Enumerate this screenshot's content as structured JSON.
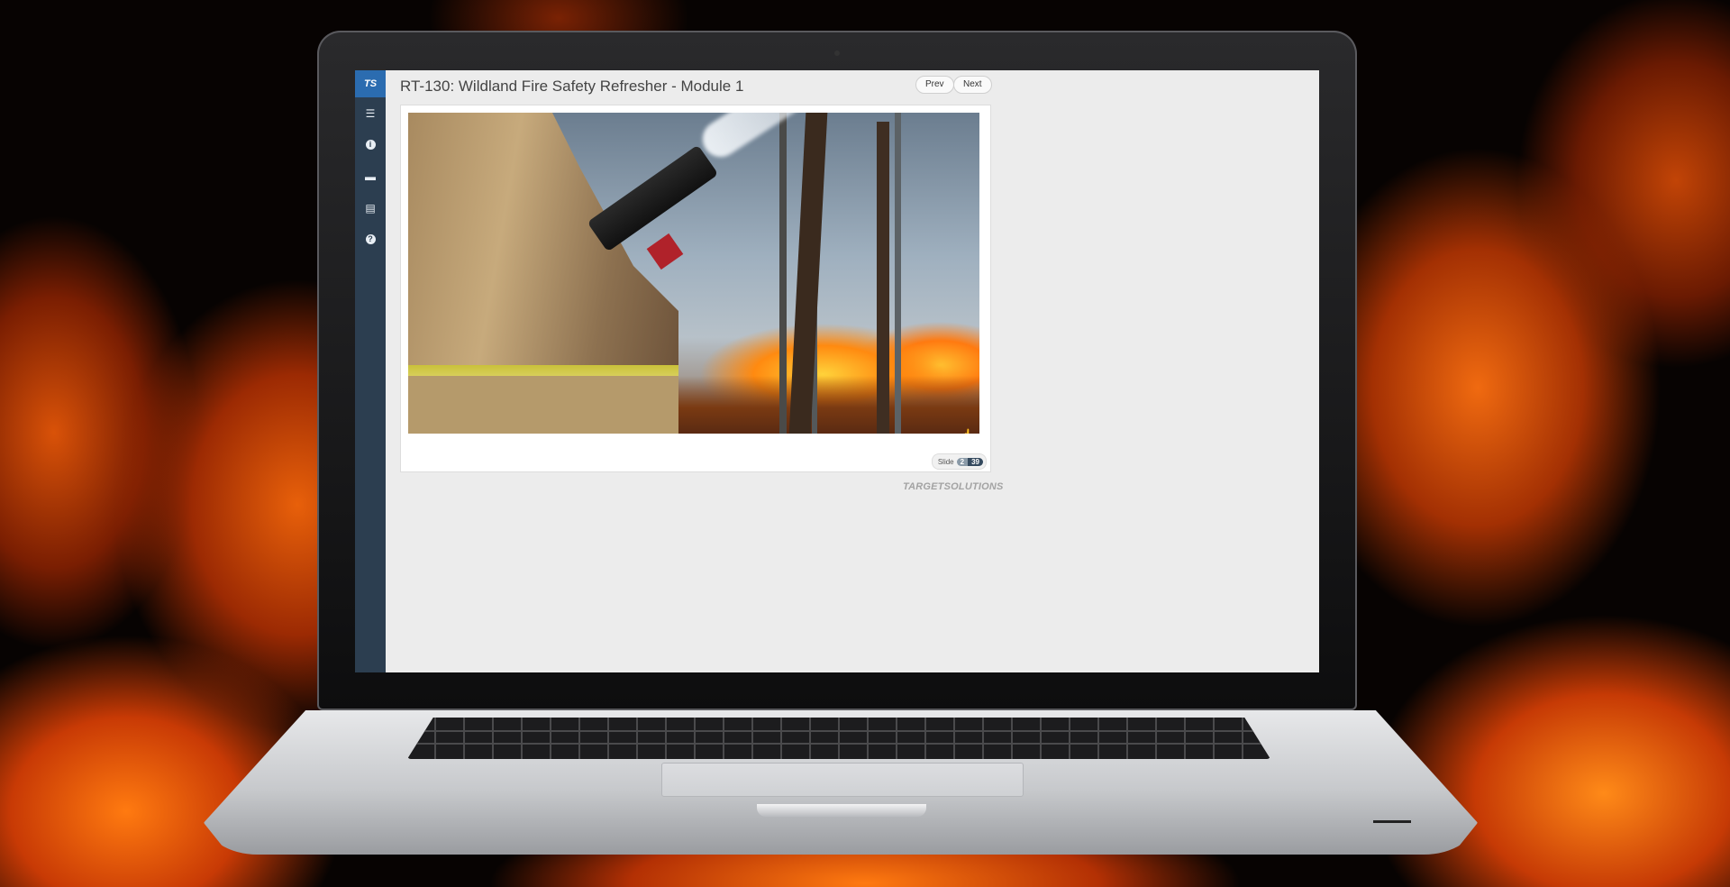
{
  "course": {
    "title": "RT-130: Wildland Fire Safety Refresher - Module 1"
  },
  "navigation": {
    "prev_label": "Prev",
    "next_label": "Next"
  },
  "sidebar": {
    "logo_text": "TS",
    "items": [
      {
        "icon": "list-icon",
        "glyph": "☰"
      },
      {
        "icon": "info-icon",
        "glyph": "i"
      },
      {
        "icon": "comment-icon",
        "glyph": "▬"
      },
      {
        "icon": "notes-icon",
        "glyph": "▤"
      },
      {
        "icon": "help-icon",
        "glyph": "?"
      }
    ]
  },
  "slide": {
    "counter_label": "Slide",
    "current": "2",
    "total": "39"
  },
  "branding": {
    "logo_text": "TARGETSOLUTIONS"
  },
  "colors": {
    "sidebar": "#2c3e50",
    "logo_accent": "#2b6cb0",
    "screen_background": "#ececec"
  }
}
